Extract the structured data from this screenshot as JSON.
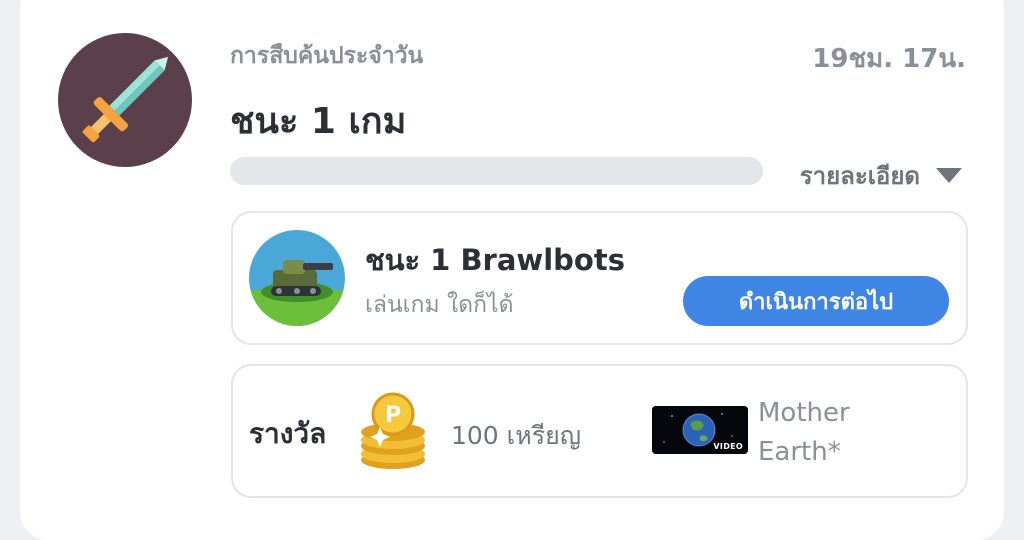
{
  "quest": {
    "icon": "sword-icon",
    "category": "การสืบค้นประจำวัน",
    "time_left": "19ชม. 17น.",
    "title": "ชนะ 1 เกม",
    "progress_fraction": 0,
    "details_label": "รายละเอียด",
    "colors": {
      "progress_track": "#e4e6ea",
      "accent": "#3f85e3"
    }
  },
  "task": {
    "thumbnail": "brawlbots-tank-icon",
    "title": "ชนะ 1 Brawlbots",
    "subtitle": "เล่นเกม ใดก็ได้",
    "action_label": "ดำเนินการต่อไป"
  },
  "reward": {
    "label": "รางวัล",
    "coin_icon": "coin-stack-icon",
    "coins_text": "100 เหรียญ",
    "video_tag": "VIDEO",
    "video_title_line1": "Mother",
    "video_title_line2": "Earth*"
  }
}
